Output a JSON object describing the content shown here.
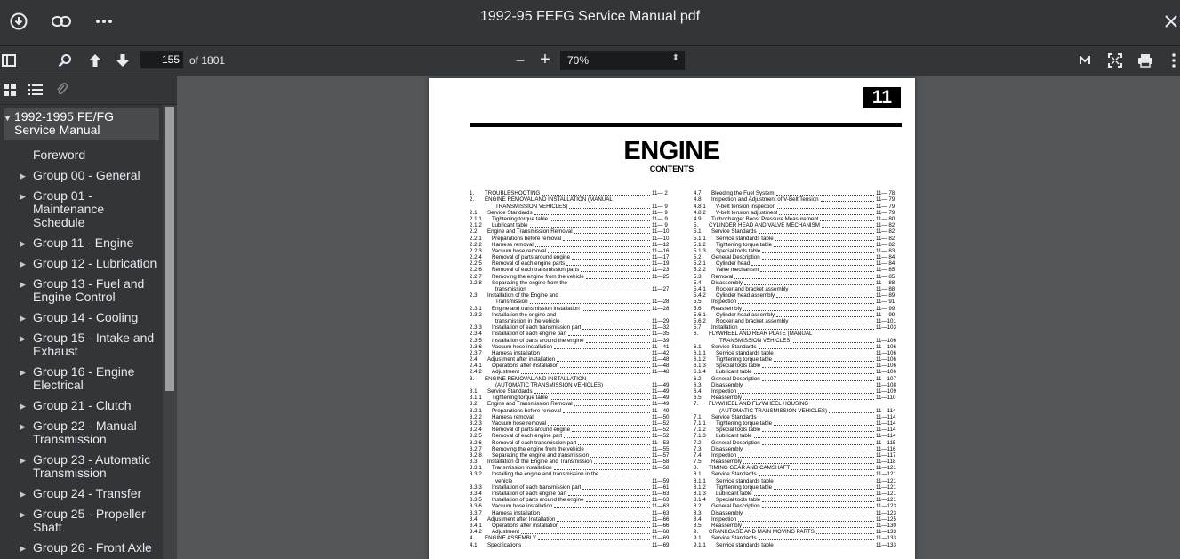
{
  "titlebar": {
    "title": "1992-95 FEFG Service Manual.pdf",
    "download_icon": "download-icon",
    "link_icon": "link-icon",
    "more_icon": "more-icon",
    "close_icon": "close-icon"
  },
  "toolbar": {
    "page_current": "155",
    "page_total": "of 1801",
    "zoom_minus": "−",
    "zoom_plus": "+",
    "zoom_value": "70%"
  },
  "sidebar": {
    "outline": {
      "root": "1992-1995 FE/FG Service Manual",
      "items": [
        {
          "label": "Foreword",
          "caret": false
        },
        {
          "label": "Group 00 - General",
          "caret": true
        },
        {
          "label": "Group 01 - Maintenance Schedule",
          "caret": true
        },
        {
          "label": "Group 11 - Engine",
          "caret": true
        },
        {
          "label": "Group 12 - Lubrication",
          "caret": true
        },
        {
          "label": "Group 13 - Fuel and Engine Control",
          "caret": true
        },
        {
          "label": "Group 14 - Cooling",
          "caret": true
        },
        {
          "label": "Group 15 - Intake and Exhaust",
          "caret": true
        },
        {
          "label": "Group 16 - Engine Electrical",
          "caret": true
        },
        {
          "label": "Group 21 - Clutch",
          "caret": true
        },
        {
          "label": "Group 22 - Manual Transmission",
          "caret": true
        },
        {
          "label": "Group 23 - Automatic Transmission",
          "caret": true
        },
        {
          "label": "Group 24 - Transfer",
          "caret": true
        },
        {
          "label": "Group 25 - Propeller Shaft",
          "caret": true
        },
        {
          "label": "Group 26 - Front Axle",
          "caret": true
        },
        {
          "label": "Group 27 - Rear Axle",
          "caret": true
        }
      ]
    }
  },
  "pdf_page": {
    "chapter_number": "11",
    "title": "ENGINE",
    "subtitle": "CONTENTS",
    "toc_left": [
      [
        "1.",
        "TROUBLESHOOTING",
        "11— 2"
      ],
      [
        "2.",
        "ENGINE REMOVAL AND INSTALLATION (MANUAL",
        ""
      ],
      [
        "",
        "TRANSMISSION VEHICLES)",
        "11— 9"
      ],
      [
        "2.1",
        "Service Standards",
        "11— 9"
      ],
      [
        "2.1.1",
        "Tightening torque table",
        "11— 9"
      ],
      [
        "2.1.2",
        "Lubricant table",
        "11— 9"
      ],
      [
        "2.2",
        "Engine and Transmission Removal",
        "11—10"
      ],
      [
        "2.2.1",
        "Preparations before removal",
        "11—10"
      ],
      [
        "2.2.2",
        "Harness removal",
        "11—12"
      ],
      [
        "2.2.3",
        "Vacuum hose removal",
        "11—16"
      ],
      [
        "2.2.4",
        "Removal of parts around engine",
        "11—17"
      ],
      [
        "2.2.5",
        "Removal of each engine parts",
        "11—19"
      ],
      [
        "2.2.6",
        "Removal of each transmission parts",
        "11—23"
      ],
      [
        "2.2.7",
        "Removing the engine from the vehicle",
        "11—25"
      ],
      [
        "2.2.8",
        "Separating the engine from the",
        ""
      ],
      [
        "",
        "transmission",
        "11—27"
      ],
      [
        "2.3",
        "Installation of the Engine and",
        ""
      ],
      [
        "",
        "Transmission",
        "11—28"
      ],
      [
        "2.3.1",
        "Engine and transmission installation",
        "11—28"
      ],
      [
        "2.3.2",
        "Installation the engine and",
        ""
      ],
      [
        "",
        "transmission in the vehicle",
        "11—29"
      ],
      [
        "2.3.3",
        "Installation of each transmission part",
        "11—32"
      ],
      [
        "2.3.4",
        "Installation of each engine part",
        "11—35"
      ],
      [
        "2.3.5",
        "Installation of parts around the engine",
        "11—39"
      ],
      [
        "2.3.6",
        "Vacuum hose installation",
        "11—41"
      ],
      [
        "2.3.7",
        "Harness installation",
        "11—42"
      ],
      [
        "2.4",
        "Adjustment after installation",
        "11—48"
      ],
      [
        "2.4.1",
        "Operations after installation",
        "11—48"
      ],
      [
        "2.4.2",
        "Adjustment",
        "11—48"
      ],
      [
        "3.",
        "ENGINE REMOVAL AND INSTALLATION",
        ""
      ],
      [
        "",
        "(AUTOMATIC TRANSMISSION VEHICLES)",
        "11—49"
      ],
      [
        "3.1",
        "Service Standards",
        "11—49"
      ],
      [
        "3.1.1",
        "Tightening torque table",
        "11—49"
      ],
      [
        "3.2",
        "Engine and Transmission Removal",
        "11—49"
      ],
      [
        "3.2.1",
        "Preparations before removal",
        "11—49"
      ],
      [
        "3.2.2",
        "Harness removal",
        "11—50"
      ],
      [
        "3.2.3",
        "Vacuum hose removal",
        "11—52"
      ],
      [
        "3.2.4",
        "Removal of parts around engine",
        "11—52"
      ],
      [
        "3.2.5",
        "Removal of each engine part",
        "11—52"
      ],
      [
        "3.2.6",
        "Removal of each transmission part",
        "11—53"
      ],
      [
        "3.2.7",
        "Removing the engine from the vehicle",
        "11—55"
      ],
      [
        "3.2.8",
        "Separating the engine and transmission",
        "11—57"
      ],
      [
        "3.3",
        "Installation of the Engine and Transmission",
        "11—58"
      ],
      [
        "3.3.1",
        "Transmission installation",
        "11—58"
      ],
      [
        "3.3.2",
        "Installing the engine and transmission in the",
        ""
      ],
      [
        "",
        "vehicle",
        "11—59"
      ],
      [
        "3.3.3",
        "Installation of each transmission part",
        "11—61"
      ],
      [
        "3.3.4",
        "Installation of each engine part",
        "11—63"
      ],
      [
        "3.3.5",
        "Installation of parts around the engine",
        "11—63"
      ],
      [
        "3.3.6",
        "Vacuum hose installation",
        "11—63"
      ],
      [
        "3.3.7",
        "Harness installation",
        "11—63"
      ],
      [
        "3.4",
        "Adjustment after Installation",
        "11—66"
      ],
      [
        "3.4.1",
        "Operations after installation",
        "11—66"
      ],
      [
        "3.4.2",
        "Adjustment",
        "11—68"
      ],
      [
        "4.",
        "ENGINE ASSEMBLY",
        "11—69"
      ],
      [
        "4.1",
        "Specifications",
        "11—69"
      ]
    ],
    "toc_right": [
      [
        "4.7",
        "Bleeding the Fuel System",
        "11— 78"
      ],
      [
        "4.8",
        "Inspection and Adjustment of V-Belt Tension",
        "11— 79"
      ],
      [
        "4.8.1",
        "V-belt tension inspection",
        "11— 79"
      ],
      [
        "4.8.2",
        "V-belt tension adjustment",
        "11— 79"
      ],
      [
        "4.9",
        "Turbocharger Boost Pressure Measurement",
        "11— 80"
      ],
      [
        "5.",
        "CYLINDER HEAD AND VALVE MECHANISM",
        "11— 82"
      ],
      [
        "5.1",
        "Service Standards",
        "11— 82"
      ],
      [
        "5.1.1",
        "Service standards table",
        "11— 82"
      ],
      [
        "5.1.2",
        "Tightening torque table",
        "11— 82"
      ],
      [
        "5.1.3",
        "Special tools table",
        "11— 83"
      ],
      [
        "5.2",
        "General Description",
        "11— 84"
      ],
      [
        "5.2.1",
        "Cylinder head",
        "11— 84"
      ],
      [
        "5.2.2",
        "Valve mechanism",
        "11— 85"
      ],
      [
        "5.3",
        "Removal",
        "11— 85"
      ],
      [
        "5.4",
        "Disassembly",
        "11— 88"
      ],
      [
        "5.4.1",
        "Rocker and bracket assembly",
        "11— 88"
      ],
      [
        "5.4.2",
        "Cylinder head assembly",
        "11— 89"
      ],
      [
        "5.5",
        "Inspection",
        "11— 91"
      ],
      [
        "5.6",
        "Reassembly",
        "11— 99"
      ],
      [
        "5.6.1",
        "Cylinder head assembly",
        "11— 99"
      ],
      [
        "5.6.2",
        "Rocker and bracket assembly",
        "11—101"
      ],
      [
        "5.7",
        "Installation",
        "11—103"
      ],
      [
        "6.",
        "FLYWHEEL AND REAR PLATE (MANUAL",
        ""
      ],
      [
        "",
        "TRANSMISSION VEHICLES)",
        "11—106"
      ],
      [
        "6.1",
        "Service Standards",
        "11—106"
      ],
      [
        "6.1.1",
        "Service standards table",
        "11—106"
      ],
      [
        "6.1.2",
        "Tightening torque table",
        "11—106"
      ],
      [
        "6.1.3",
        "Special tools table",
        "11—106"
      ],
      [
        "6.1.4",
        "Lubricant table",
        "11—106"
      ],
      [
        "6.2",
        "General Description",
        "11—107"
      ],
      [
        "6.3",
        "Disassembly",
        "11—108"
      ],
      [
        "6.4",
        "Inspection",
        "11—109"
      ],
      [
        "6.5",
        "Reassembly",
        "11—110"
      ],
      [
        "7.",
        "FLYWHEEL AND FLYWHEEL HOUSING",
        ""
      ],
      [
        "",
        "(AUTOMATIC TRANSMISSION VEHICLES)",
        "11—114"
      ],
      [
        "7.1",
        "Service Standards",
        "11—114"
      ],
      [
        "7.1.1",
        "Tightening torque table",
        "11—114"
      ],
      [
        "7.1.2",
        "Special tools table",
        "11—114"
      ],
      [
        "7.1.3",
        "Lubricant table",
        "11—114"
      ],
      [
        "7.2",
        "General Description",
        "11—115"
      ],
      [
        "7.3",
        "Disassembly",
        "11—116"
      ],
      [
        "7.4",
        "Inspection",
        "11—117"
      ],
      [
        "7.5",
        "Reassembly",
        "11—118"
      ],
      [
        "8.",
        "TIMING GEAR AND CAMSHAFT",
        "11—121"
      ],
      [
        "8.1",
        "Service Standards",
        "11—121"
      ],
      [
        "8.1.1",
        "Service standards table",
        "11—121"
      ],
      [
        "8.1.2",
        "Tightening torque table",
        "11—121"
      ],
      [
        "8.1.3",
        "Lubricant table",
        "11—121"
      ],
      [
        "8.1.4",
        "Special tools table",
        "11—121"
      ],
      [
        "8.2",
        "General Description",
        "11—123"
      ],
      [
        "8.3",
        "Disassembly",
        "11—123"
      ],
      [
        "8.4",
        "Inspection",
        "11—125"
      ],
      [
        "8.5",
        "Reassembly",
        "11—130"
      ],
      [
        "9.",
        "CRANKCASE AND MAIN MOVING PARTS",
        "11—133"
      ],
      [
        "9.1",
        "Service Standards",
        "11—133"
      ],
      [
        "9.1.1",
        "Service standards table",
        "11—133"
      ]
    ]
  }
}
